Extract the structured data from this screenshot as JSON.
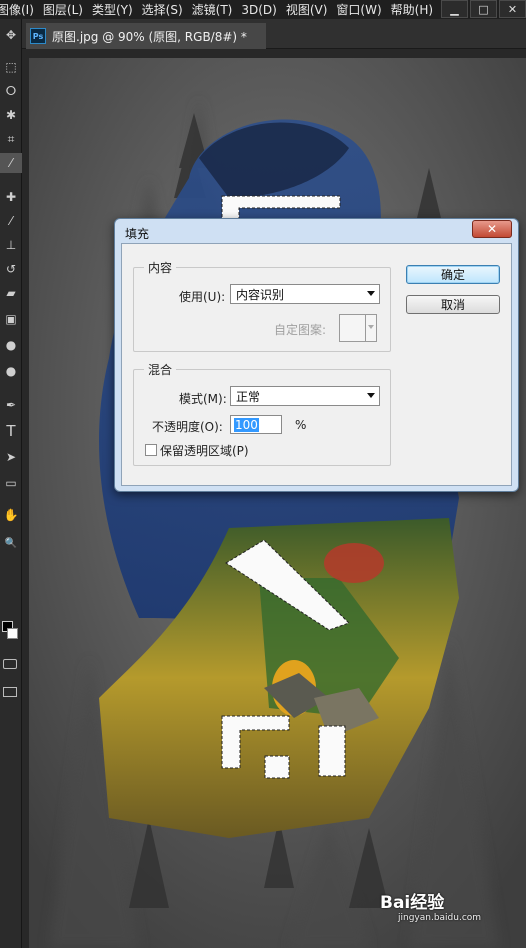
{
  "menu": [
    "图像(I)",
    "图层(L)",
    "类型(Y)",
    "选择(S)",
    "滤镜(T)",
    "3D(D)",
    "视图(V)",
    "窗口(W)",
    "帮助(H)"
  ],
  "window_buttons": [
    "▁",
    "□",
    "✕"
  ],
  "tab": {
    "ps_badge": "Ps",
    "title": "原图.jpg @ 90% (原图, RGB/8#) *"
  },
  "tools": [
    "move-icon",
    "marquee-icon",
    "lasso-icon",
    "magic-wand-icon",
    "crop-icon",
    "eyedropper-icon",
    "healing-brush-icon",
    "brush-icon",
    "clone-stamp-icon",
    "history-brush-icon",
    "eraser-icon",
    "gradient-icon",
    "blur-icon",
    "dodge-icon",
    "pen-icon",
    "type-icon",
    "path-select-icon",
    "shape-icon",
    "hand-icon",
    "zoom-icon"
  ],
  "tool_glyphs": [
    "✥",
    "⬚",
    "ⵔ",
    "✱",
    "⌗",
    "⁄",
    "✚",
    "⁄",
    "⊥",
    "↺",
    "▰",
    "▣",
    "●",
    "●",
    "✒",
    "T",
    "➤",
    "▭",
    "✋",
    "🔍"
  ],
  "type_tool_label": "T",
  "dialog": {
    "title": "填充",
    "close": "✕",
    "content_group": "内容",
    "use_label": "使用(U):",
    "use_value": "内容识别",
    "pattern_label": "自定图案:",
    "blend_group": "混合",
    "mode_label": "模式(M):",
    "mode_value": "正常",
    "opacity_label": "不透明度(O):",
    "opacity_value": "100",
    "opacity_unit": "%",
    "preserve_label": "保留透明区域(P)",
    "preserve_checked": false,
    "ok": "确定",
    "cancel": "取消"
  },
  "watermark": {
    "logo": "Bai经验",
    "url": "jingyan.baidu.com"
  },
  "colors": {
    "accent": "#3399ff",
    "dialog_frame": "#cfe0f3",
    "close_red": "#c24a34"
  }
}
